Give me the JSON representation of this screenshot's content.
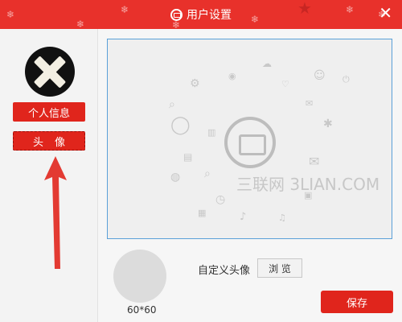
{
  "window": {
    "title": "用户设置",
    "close_label": "✕"
  },
  "sidebar": {
    "items": [
      {
        "label": "个人信息"
      },
      {
        "label": "头像"
      }
    ]
  },
  "main": {
    "watermark": "三联网 3LIAN.COM",
    "avatar_size_label": "60*60",
    "custom_avatar_label": "自定义头像",
    "browse_label": "浏 览",
    "save_label": "保存"
  },
  "colors": {
    "titlebar": "#e8312b",
    "accent_button": "#e0251c",
    "preview_border": "#5aa0d8"
  },
  "icons": [
    "app-logo-icon",
    "close-icon",
    "x-avatar-icon",
    "arrow-up-icon",
    "mail-icon",
    "decorative-icon-cloud"
  ]
}
